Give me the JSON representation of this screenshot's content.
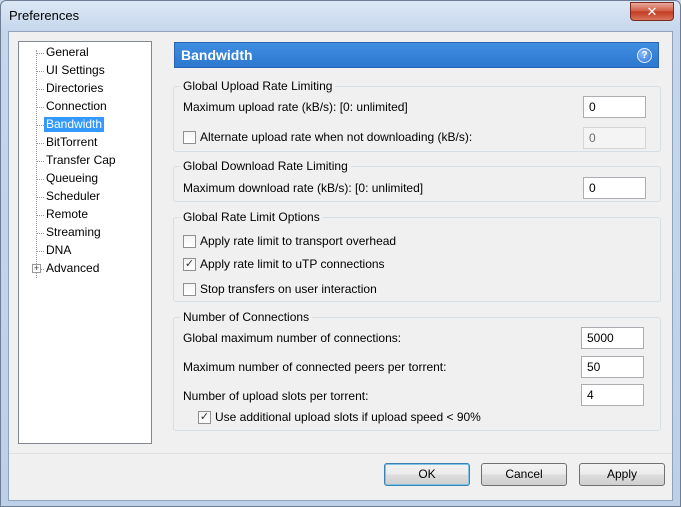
{
  "window": {
    "title": "Preferences",
    "close_glyph": "✕"
  },
  "tree": {
    "items": [
      {
        "label": "General"
      },
      {
        "label": "UI Settings"
      },
      {
        "label": "Directories"
      },
      {
        "label": "Connection"
      },
      {
        "label": "Bandwidth"
      },
      {
        "label": "BitTorrent"
      },
      {
        "label": "Transfer Cap"
      },
      {
        "label": "Queueing"
      },
      {
        "label": "Scheduler"
      },
      {
        "label": "Remote"
      },
      {
        "label": "Streaming"
      },
      {
        "label": "DNA"
      },
      {
        "label": "Advanced"
      }
    ],
    "expander_glyph": "+"
  },
  "header": {
    "title": "Bandwidth",
    "help_glyph": "?"
  },
  "upload": {
    "title": "Global Upload Rate Limiting",
    "max_label": "Maximum upload rate (kB/s): [0: unlimited]",
    "max_value": "0",
    "alt_label": "Alternate upload rate when not downloading (kB/s):",
    "alt_checked": false,
    "alt_value": "0"
  },
  "download": {
    "title": "Global Download Rate Limiting",
    "max_label": "Maximum download rate (kB/s): [0: unlimited]",
    "max_value": "0"
  },
  "options": {
    "title": "Global Rate Limit Options",
    "transport_label": "Apply rate limit to transport overhead",
    "transport_checked": false,
    "utp_label": "Apply rate limit to uTP connections",
    "utp_checked": true,
    "stop_label": "Stop transfers on user interaction",
    "stop_checked": false
  },
  "connections": {
    "title": "Number of Connections",
    "global_label": "Global maximum number of connections:",
    "global_value": "5000",
    "peers_label": "Maximum number of connected peers per torrent:",
    "peers_value": "50",
    "slots_label": "Number of upload slots per torrent:",
    "slots_value": "4",
    "extra_label": "Use additional upload slots if upload speed < 90%",
    "extra_checked": true
  },
  "buttons": {
    "ok": "OK",
    "cancel": "Cancel",
    "apply": "Apply"
  },
  "checkmark_glyph": "✓"
}
